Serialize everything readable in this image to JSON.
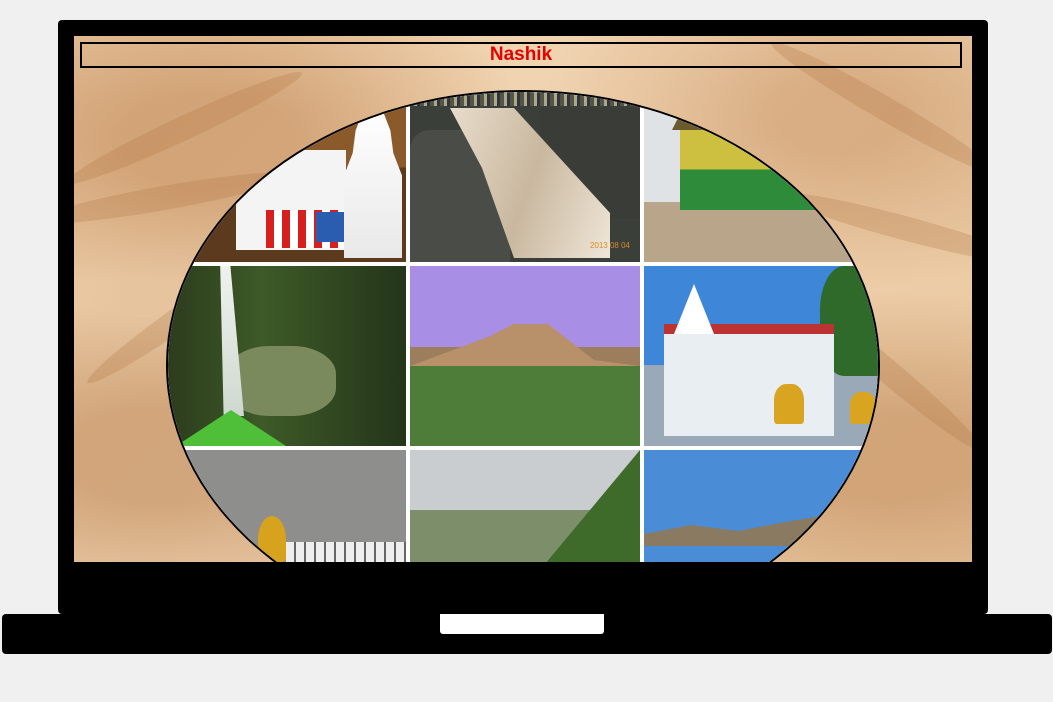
{
  "header": {
    "title": "Nashik"
  },
  "gallery": {
    "photos": [
      {
        "subject": "temple"
      },
      {
        "subject": "waterfall",
        "date_stamp": "2013 08 04"
      },
      {
        "subject": "shrine"
      },
      {
        "subject": "waterfall-forest"
      },
      {
        "subject": "mountain"
      },
      {
        "subject": "temple-lions"
      },
      {
        "subject": "idol"
      },
      {
        "subject": "valley"
      },
      {
        "subject": "plateau"
      }
    ]
  },
  "colors": {
    "title": "#e60000",
    "bezel": "#000000",
    "background": "#f0f0f0"
  }
}
